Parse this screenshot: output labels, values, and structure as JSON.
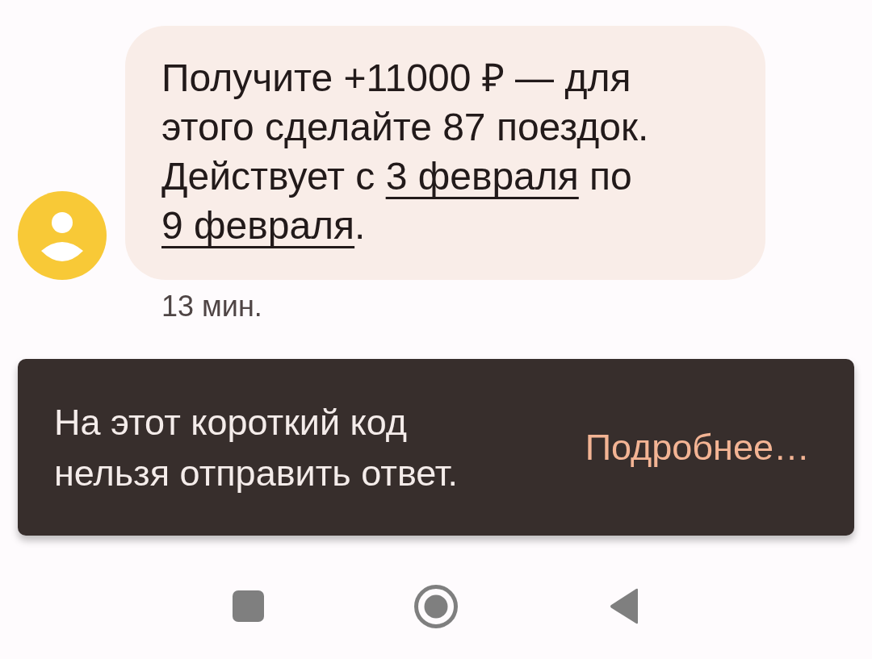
{
  "message": {
    "text": [
      {
        "kind": "text",
        "text": "Получите +11000 ₽ — для этого сделайте 87 поездок. Действует с "
      },
      {
        "kind": "link",
        "text": "3 февраля"
      },
      {
        "kind": "text",
        "text": " по "
      },
      {
        "kind": "link",
        "text": "9 февраля"
      },
      {
        "kind": "text",
        "text": "."
      }
    ],
    "time": "13 мин."
  },
  "snackbar": {
    "text": "На этот короткий код нельзя отправить ответ.",
    "action": "Подробнее…"
  }
}
